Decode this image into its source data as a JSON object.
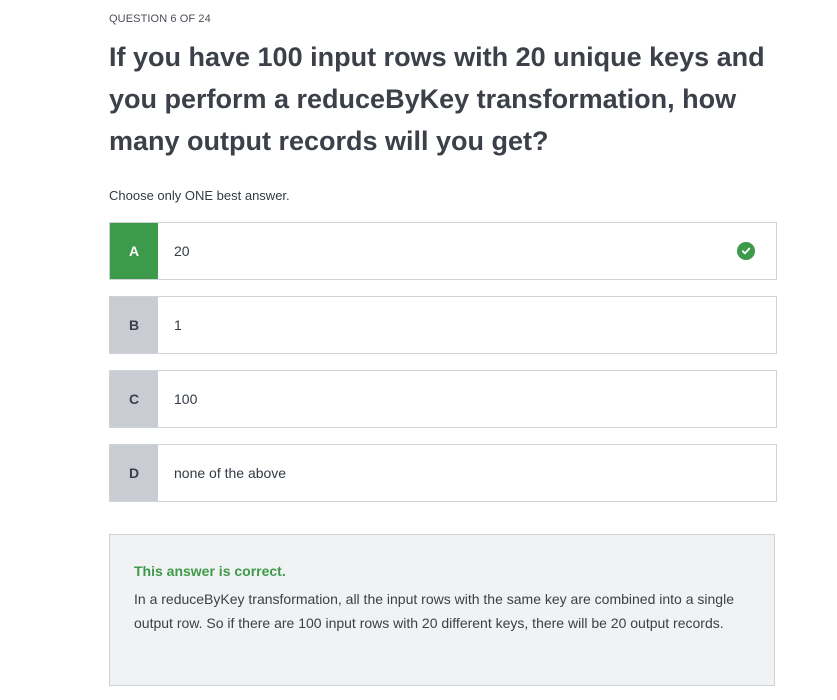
{
  "quiz": {
    "counter": "QUESTION 6 OF 24",
    "question": "If you have 100 input rows with 20 unique keys and you perform a reduceByKey transformation, how many output records will you get?",
    "instruction": "Choose only ONE best answer.",
    "options": [
      {
        "letter": "A",
        "text": "20",
        "state": "correct"
      },
      {
        "letter": "B",
        "text": "1",
        "state": "unselected"
      },
      {
        "letter": "C",
        "text": "100",
        "state": "unselected"
      },
      {
        "letter": "D",
        "text": "none of the above",
        "state": "unselected"
      }
    ],
    "correct_icon": "check-circle-icon"
  },
  "feedback": {
    "verdict": "This answer is correct.",
    "explanation": "In a reduceByKey transformation, all the input rows with the same key are combined into a single output row. So if there are 100 input rows with 20 different keys, there will be 20 output records."
  },
  "colors": {
    "correct_green": "#3d9a4a",
    "letter_gray": "#c9cdd3",
    "panel_bg": "#f1f2f3",
    "border": "#cfd3d8"
  }
}
